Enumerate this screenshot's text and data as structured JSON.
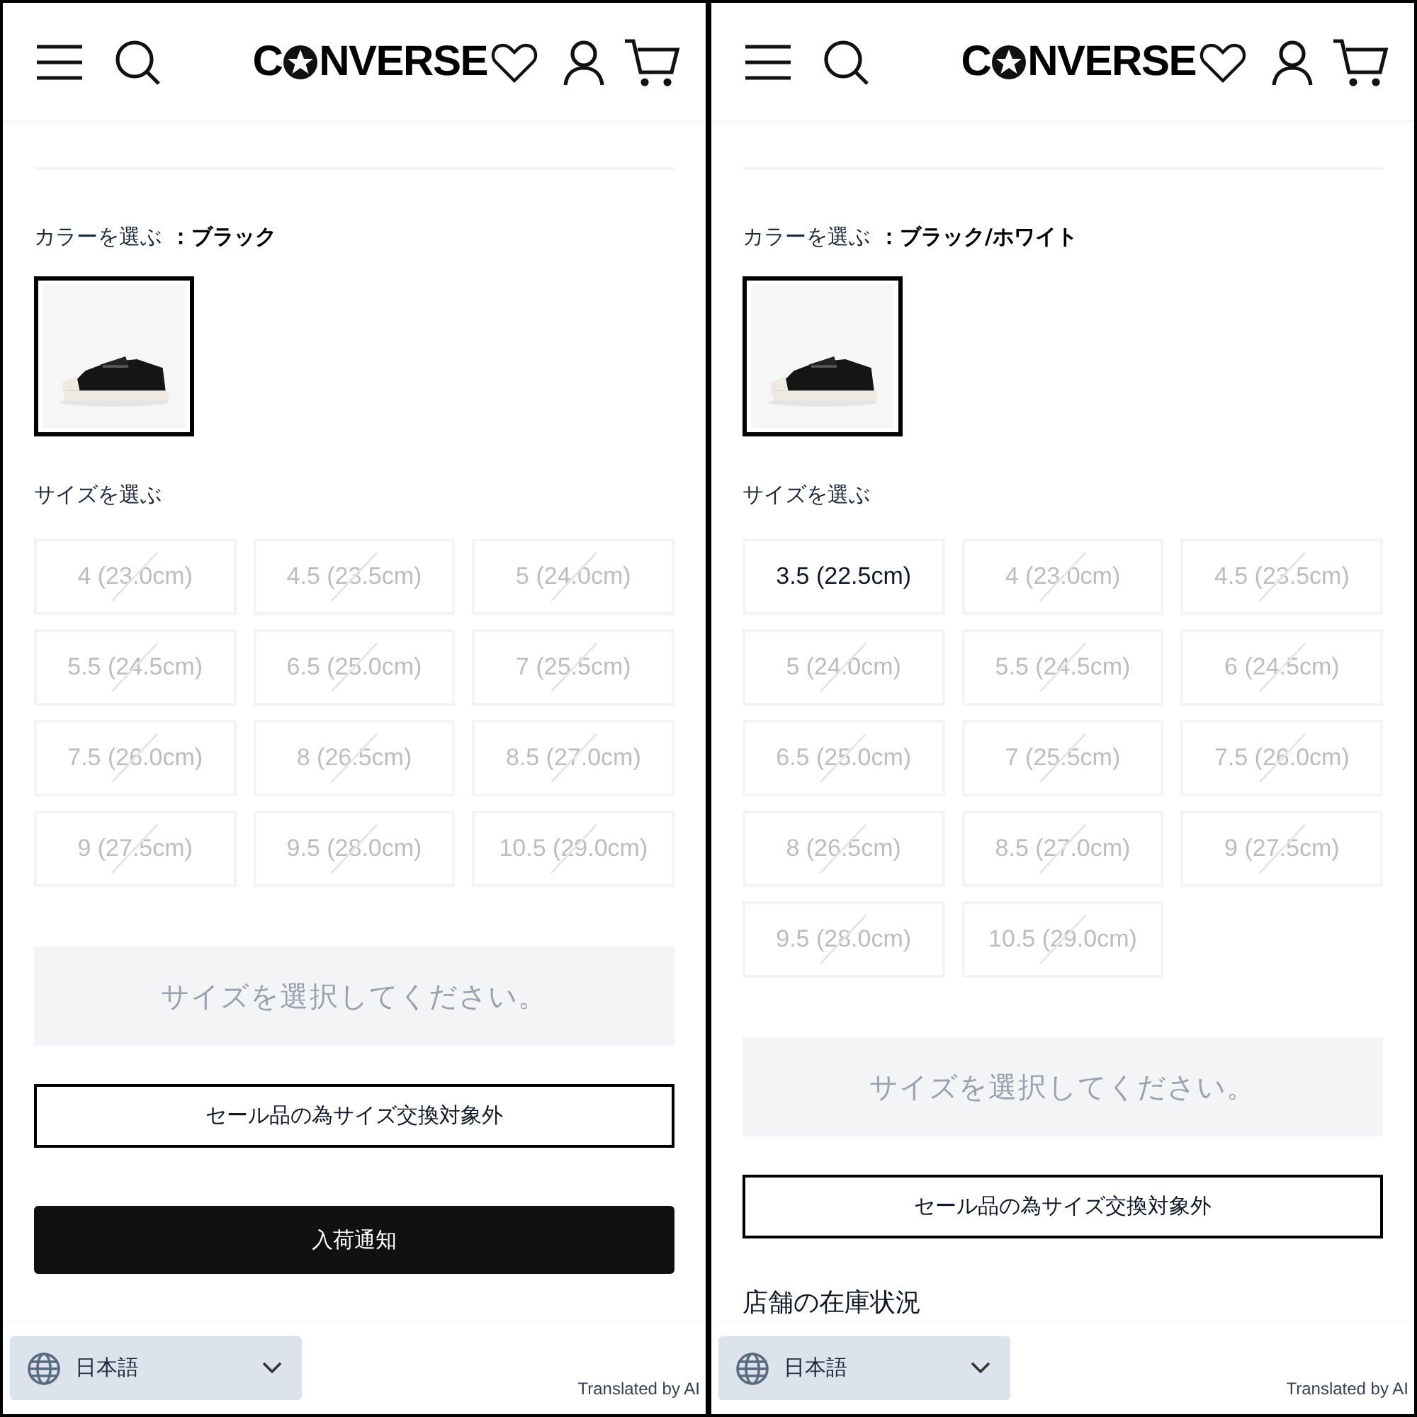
{
  "panels": [
    {
      "header": {
        "logo_start": "C",
        "logo_end": "NVERSE"
      },
      "color_label": "カラーを選ぶ",
      "color_value": "：ブラック",
      "swatches": [
        {
          "kind": "picture",
          "selected": true
        }
      ],
      "size_label": "サイズを選ぶ",
      "sizes": [
        {
          "label": "4 (23.0cm)",
          "available": false
        },
        {
          "label": "4.5 (23.5cm)",
          "available": false
        },
        {
          "label": "5 (24.0cm)",
          "available": false
        },
        {
          "label": "5.5 (24.5cm)",
          "available": false
        },
        {
          "label": "6.5 (25.0cm)",
          "available": false
        },
        {
          "label": "7 (25.5cm)",
          "available": false
        },
        {
          "label": "7.5 (26.0cm)",
          "available": false
        },
        {
          "label": "8 (26.5cm)",
          "available": false
        },
        {
          "label": "8.5 (27.0cm)",
          "available": false
        },
        {
          "label": "9 (27.5cm)",
          "available": false
        },
        {
          "label": "9.5 (28.0cm)",
          "available": false
        },
        {
          "label": "10.5 (29.0cm)",
          "available": false
        }
      ],
      "select_button": {
        "label": "サイズを選択してください。",
        "disabled": true
      },
      "notice": "セール品の為サイズ交換対象外",
      "notify_button": "入荷通知",
      "footer": {
        "language": "日本語",
        "credit": "Translated by AI"
      }
    },
    {
      "header": {
        "logo_start": "C",
        "logo_end": "NVERSE"
      },
      "color_label": "カラーを選ぶ",
      "color_value": "：ブラック/ホワイト",
      "swatches": [
        {
          "kind": "picture",
          "selected": true
        }
      ],
      "size_label": "サイズを選ぶ",
      "sizes": [
        {
          "label": "3.5 (22.5cm)",
          "available": true
        },
        {
          "label": "4 (23.0cm)",
          "available": false
        },
        {
          "label": "4.5 (23.5cm)",
          "available": false
        },
        {
          "label": "5 (24.0cm)",
          "available": false
        },
        {
          "label": "5.5 (24.5cm)",
          "available": false
        },
        {
          "label": "6 (24.5cm)",
          "available": false
        },
        {
          "label": "6.5 (25.0cm)",
          "available": false
        },
        {
          "label": "7 (25.5cm)",
          "available": false
        },
        {
          "label": "7.5 (26.0cm)",
          "available": false
        },
        {
          "label": "8 (26.5cm)",
          "available": false
        },
        {
          "label": "8.5 (27.0cm)",
          "available": false
        },
        {
          "label": "9 (27.5cm)",
          "available": false
        },
        {
          "label": "9.5 (28.0cm)",
          "available": false
        },
        {
          "label": "10.5 (29.0cm)",
          "available": false
        }
      ],
      "select_button": {
        "label": "サイズを選択してください。",
        "disabled": true
      },
      "notice": "セール品の為サイズ交換対象外",
      "store_heading": "店舗の在庫状況",
      "footer": {
        "language": "日本語",
        "credit": "Translated by AI"
      }
    }
  ]
}
